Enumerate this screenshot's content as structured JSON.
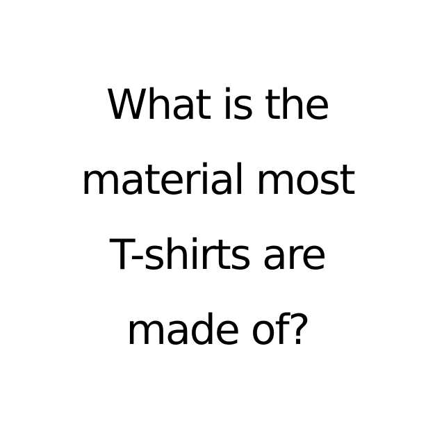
{
  "question": {
    "lines": [
      "What is the",
      "material most",
      "T-shirts are",
      "made of?"
    ]
  },
  "colors": {
    "background": "#ffffff",
    "text": "#000000"
  }
}
